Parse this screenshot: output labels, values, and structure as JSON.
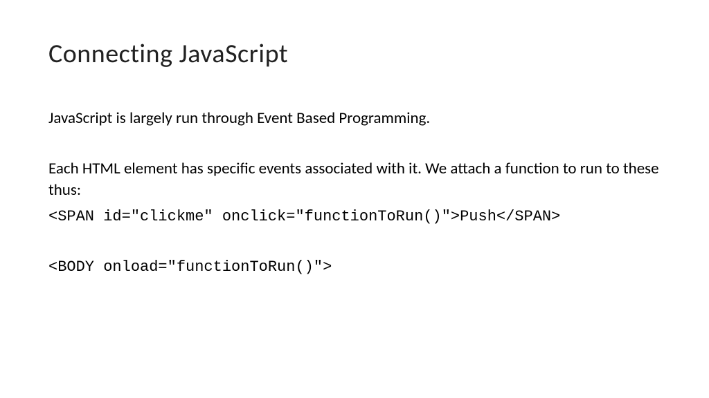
{
  "slide": {
    "title": "Connecting JavaScript",
    "para1": "JavaScript is largely run through Event Based Programming.",
    "para2": "Each HTML element has specific events associated with it. We attach a function to run to these thus:",
    "code1": "<SPAN id=\"clickme\" onclick=\"functionToRun()\">Push</SPAN>",
    "code2": "<BODY onload=\"functionToRun()\">"
  }
}
